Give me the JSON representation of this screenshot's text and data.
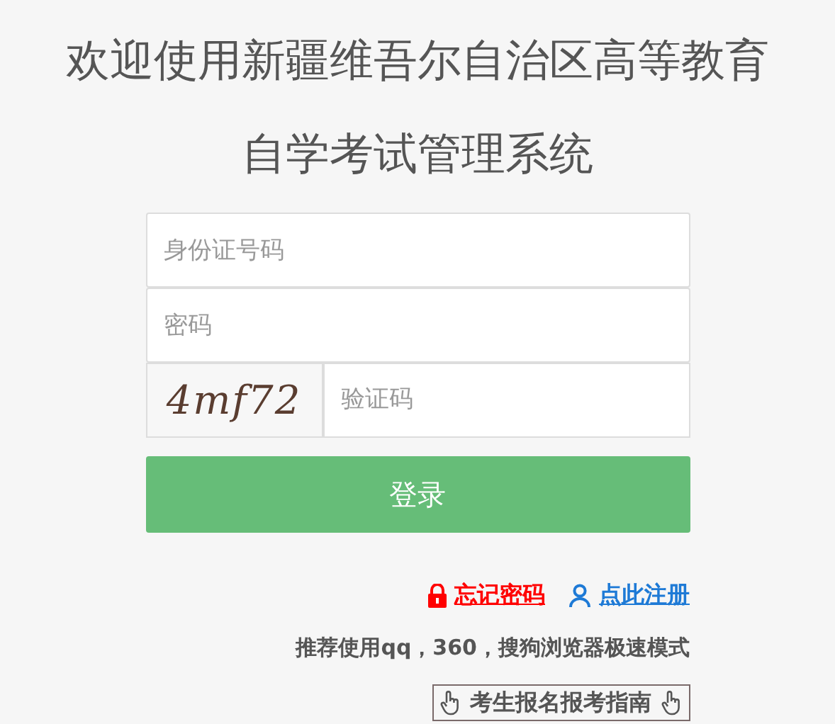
{
  "title": [
    "欢迎使用新疆维吾尔自治区高等教育",
    "自学考试管理系统"
  ],
  "form": {
    "id_field": {
      "placeholder": "身份证号码"
    },
    "password_field": {
      "placeholder": "密码"
    },
    "captcha": {
      "image_text": "4mf72",
      "placeholder": "验证码"
    },
    "submit": "登录"
  },
  "links": [
    {
      "kind": "lock",
      "label": "忘记密码",
      "color": "#ff0000"
    },
    {
      "kind": "user",
      "label": "点此注册",
      "color": "#1e7ad6"
    }
  ],
  "tip": "推荐使用qq，360，搜狗浏览器极速模式",
  "guide": "考生报名报考指南"
}
